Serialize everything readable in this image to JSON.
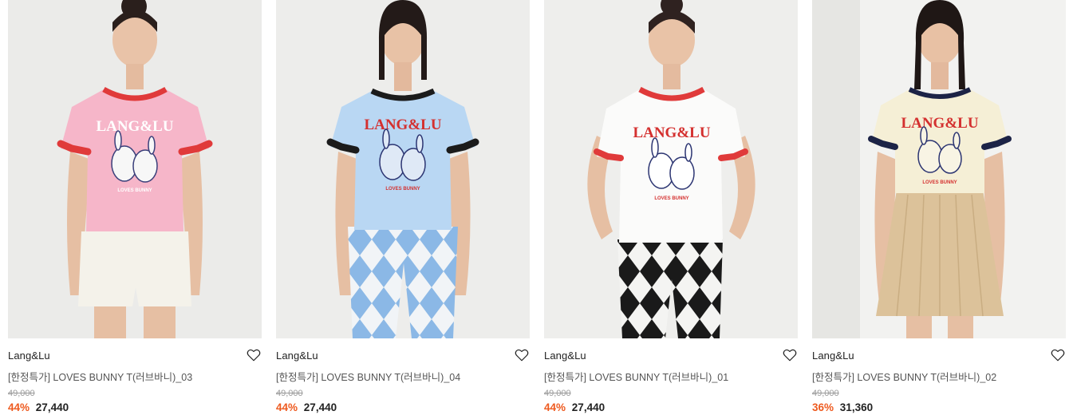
{
  "products": [
    {
      "brand": "Lang&Lu",
      "title": "[한정특가] LOVES BUNNY T(러브바니)_03",
      "original_price": "49,000",
      "discount": "44%",
      "sale_price": "27,440",
      "shirt_color": "#f6b6c9",
      "trim_color": "#e03a3a",
      "bottom": "white sequin shorts"
    },
    {
      "brand": "Lang&Lu",
      "title": "[한정특가] LOVES BUNNY T(러브바니)_04",
      "original_price": "49,000",
      "discount": "44%",
      "sale_price": "27,440",
      "shirt_color": "#b9d7f3",
      "trim_color": "#1b1b1b",
      "bottom": "blue argyle pants"
    },
    {
      "brand": "Lang&Lu",
      "title": "[한정특가] LOVES BUNNY T(러브바니)_01",
      "original_price": "49,000",
      "discount": "44%",
      "sale_price": "27,440",
      "shirt_color": "#fbfbfa",
      "trim_color": "#e03a3a",
      "bottom": "black argyle pants"
    },
    {
      "brand": "Lang&Lu",
      "title": "[한정특가] LOVES BUNNY T(러브바니)_02",
      "original_price": "49,000",
      "discount": "36%",
      "sale_price": "31,360",
      "shirt_color": "#f5efd6",
      "trim_color": "#1c2346",
      "bottom": "beige pleated skirt"
    }
  ],
  "accent_color": "#ee5a1f",
  "icons": {
    "wishlist": "heart-outline-icon"
  }
}
